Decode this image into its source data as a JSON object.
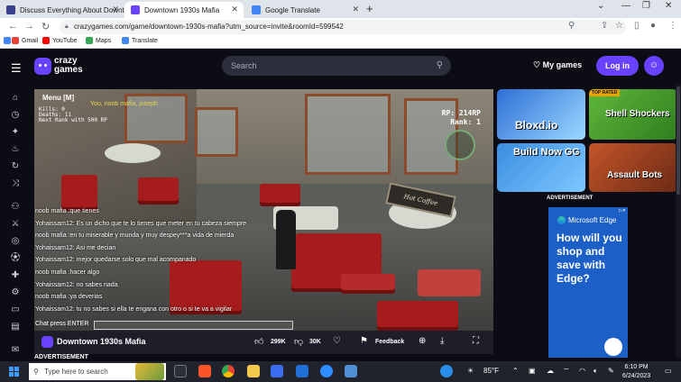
{
  "browser": {
    "tabs": [
      {
        "title": "Discuss Everything About Downt",
        "active": false
      },
      {
        "title": "Downtown 1930s Mafia",
        "active": true
      },
      {
        "title": "Google Translate",
        "active": false
      }
    ],
    "url": "crazygames.com/game/downtown-1930s-mafia?utm_source=invite&roomId=599542",
    "bookmarks": [
      "Gmail",
      "YouTube",
      "Maps",
      "Translate"
    ]
  },
  "site": {
    "logo_line1": "crazy",
    "logo_line2": "games",
    "search_placeholder": "Search",
    "my_games": "My games",
    "login": "Log in"
  },
  "game": {
    "menu": "Menu [M]",
    "stats": [
      "Kills:   0",
      "Deaths: 11",
      "Next Rank with 500 RP"
    ],
    "notice": "You, noob mafia, joseph",
    "rp": "RP: 214RP",
    "rank": "Rank: 1",
    "sign": "Hot Coffee",
    "chat": [
      "noob mafia :que tienes",
      "Yohaissam12: Es un dicho que te lo tienes que meter en tu cabeza siempre",
      "noob mafia :en tu miserable y munda y muy despey***a vida de mierda",
      "Yohaissam12: Asi me decian",
      "Yohaissam12: mejor quedarse solo que mal acompanado",
      "noob mafia :hacer algo",
      "Yohaissam12: no sabes nada",
      "noob mafia :ya deverias",
      "Yohaissam12: tu no sabes si ella te engana con otro o si te va a vigilar"
    ],
    "chat_prompt": "Chat press   ENTER"
  },
  "gamebar": {
    "title": "Downtown 1930s Mafia",
    "likes": "299K",
    "dislikes": "30K",
    "feedback": "Feedback"
  },
  "ads": {
    "below_label": "ADVERTISEMENT",
    "side_label": "ADVERTISEMENT",
    "edge_brand": "Microsoft Edge",
    "edge_text": "How will you shop and save with Edge?"
  },
  "thumbs": [
    {
      "title": "Bloxd.io",
      "color": "#2e6fd6"
    },
    {
      "title": "Shell Shockers",
      "badge": "TOP RATED",
      "color": "#5fb83a"
    },
    {
      "title": "Build Now GG",
      "color": "#3a8de0"
    },
    {
      "title": "Assault Bots",
      "color": "#c4562a"
    }
  ],
  "taskbar": {
    "search_placeholder": "Type here to search",
    "weather": "85°F",
    "time": "6:10 PM",
    "date": "6/24/2023"
  }
}
